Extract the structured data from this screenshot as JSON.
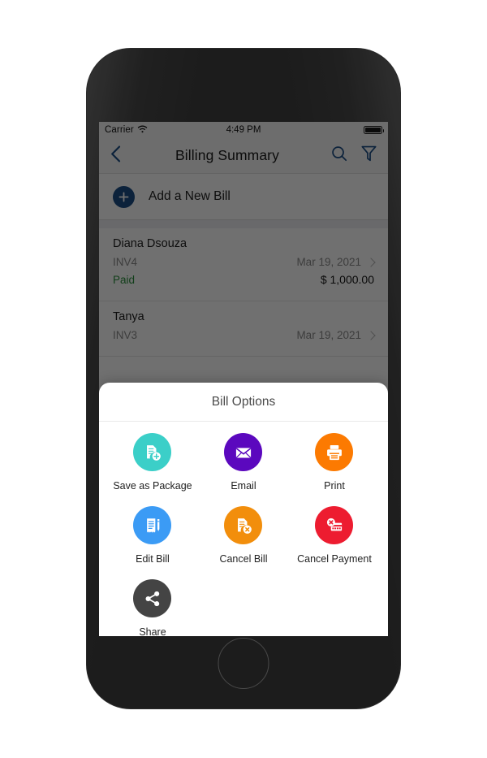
{
  "status_bar": {
    "carrier": "Carrier",
    "time": "4:49 PM",
    "wifi_icon": "wifi-icon",
    "battery_icon": "battery-icon"
  },
  "nav": {
    "title": "Billing Summary",
    "back_icon": "chevron-left-icon",
    "search_icon": "search-icon",
    "filter_icon": "filter-funnel-icon",
    "accent_color": "#1c4e86"
  },
  "add_bill": {
    "label": "Add a New Bill",
    "icon": "plus-circle-icon",
    "circle_color": "#1c4e86"
  },
  "bills": [
    {
      "name": "Diana Dsouza",
      "invoice": "INV4",
      "date": "Mar 19, 2021",
      "status": "Paid",
      "status_color": "#2a8f3d",
      "amount": "$ 1,000.00",
      "chevron_icon": "chevron-right-icon"
    },
    {
      "name": "Tanya",
      "invoice": "INV3",
      "date": "Mar 19, 2021",
      "status": "",
      "status_color": "#2a8f3d",
      "amount": "",
      "chevron_icon": "chevron-right-icon"
    }
  ],
  "modal": {
    "title": "Bill Options",
    "options": [
      {
        "label": "Save as Package",
        "icon": "document-add-icon",
        "color": "#3bcfc8"
      },
      {
        "label": "Email",
        "icon": "envelope-icon",
        "color": "#5b08be"
      },
      {
        "label": "Print",
        "icon": "printer-icon",
        "color": "#fc7a01"
      },
      {
        "label": "Edit Bill",
        "icon": "document-edit-icon",
        "color": "#3b9bf5"
      },
      {
        "label": "Cancel Bill",
        "icon": "document-x-icon",
        "color": "#f28e0c"
      },
      {
        "label": "Cancel Payment",
        "icon": "card-x-icon",
        "color": "#ed1c30"
      },
      {
        "label": "Share",
        "icon": "share-nodes-icon",
        "color": "#444444"
      }
    ]
  }
}
